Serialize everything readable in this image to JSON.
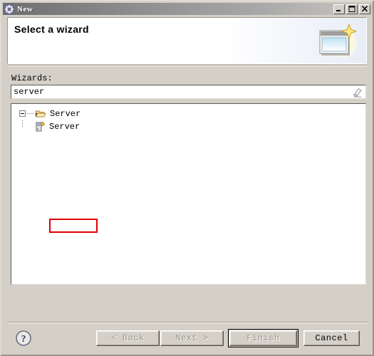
{
  "window": {
    "title": "New",
    "title_icon": "gear-icon",
    "controls": [
      {
        "name": "minimize-button",
        "glyph": "minimize-icon"
      },
      {
        "name": "maximize-button",
        "glyph": "maximize-icon"
      },
      {
        "name": "close-button",
        "glyph": "close-icon"
      }
    ]
  },
  "header": {
    "title": "Select a wizard",
    "icon": "wizard-banner-icon"
  },
  "form": {
    "wizards_label": "Wizards:",
    "filter_value": "server",
    "filter_placeholder": "",
    "filter_clear_icon": "eraser-icon"
  },
  "tree": {
    "nodes": [
      {
        "label": "Server",
        "icon": "open-folder-icon",
        "expanded": true,
        "expander": "minus-box-icon",
        "children": [
          {
            "label": "Server",
            "icon": "server-new-icon",
            "highlighted": true
          }
        ]
      }
    ]
  },
  "footer": {
    "help_icon": "help-question-icon",
    "buttons": [
      {
        "name": "back-button",
        "label": "< Back",
        "enabled": false
      },
      {
        "name": "next-button",
        "label": "Next >",
        "enabled": false
      },
      {
        "name": "finish-button",
        "label": "Finish",
        "enabled": false,
        "default": true
      },
      {
        "name": "cancel-button",
        "label": "Cancel",
        "enabled": true
      }
    ]
  },
  "colors": {
    "dialog_face": "#d4d0c8",
    "highlight_red": "#e00000",
    "field_white": "#ffffff",
    "titlebar_left": "#6e6e6e",
    "titlebar_right": "#c9c7c2"
  }
}
